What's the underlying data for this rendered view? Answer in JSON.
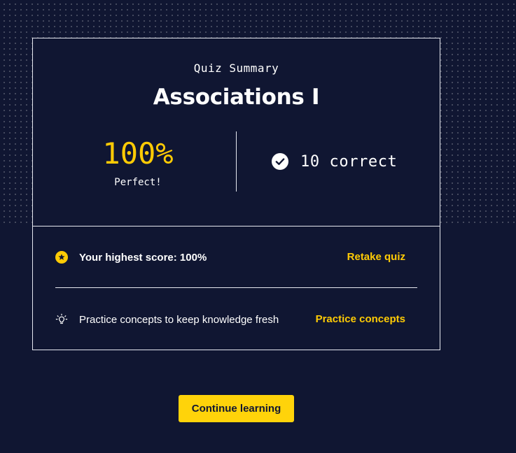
{
  "summary": {
    "subtitle": "Quiz Summary",
    "title": "Associations I",
    "score_value": "100%",
    "score_label": "Perfect!",
    "correct_text": "10 correct"
  },
  "actions": {
    "highest_score_text": "Your highest score: 100%",
    "retake_label": "Retake quiz",
    "practice_text": "Practice concepts to keep knowledge fresh",
    "practice_label": "Practice concepts"
  },
  "footer": {
    "continue_label": "Continue learning"
  },
  "icons": {
    "check": "check-circle-icon",
    "star": "star-circle-icon",
    "lightbulb": "lightbulb-icon"
  },
  "colors": {
    "background": "#101632",
    "accent": "#ffcb05",
    "button": "#ffd30a",
    "text": "#ffffff"
  }
}
